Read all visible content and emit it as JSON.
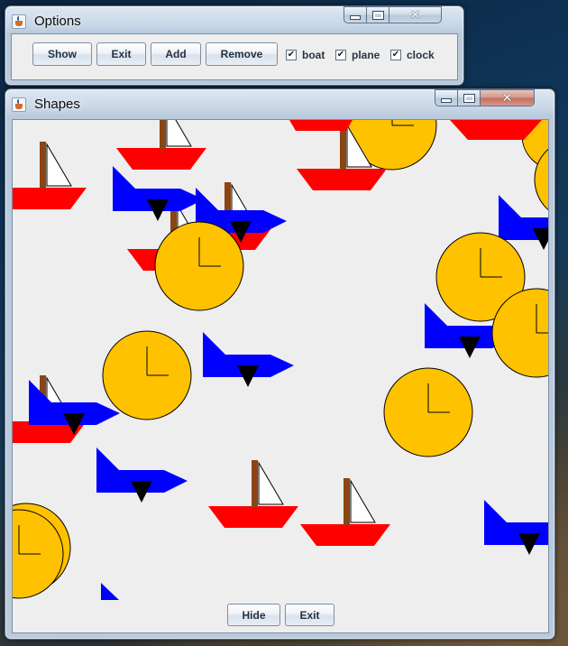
{
  "options_window": {
    "title": "Options",
    "buttons": {
      "show": "Show",
      "exit": "Exit",
      "add": "Add",
      "remove": "Remove"
    },
    "checkboxes": [
      {
        "label": "boat",
        "checked": true,
        "mark": "✔"
      },
      {
        "label": "plane",
        "checked": true,
        "mark": "✔"
      },
      {
        "label": "clock",
        "checked": true,
        "mark": "✔"
      }
    ]
  },
  "shapes_window": {
    "title": "Shapes",
    "buttons": {
      "hide": "Hide",
      "exit": "Exit"
    }
  },
  "caption_icons": {
    "minimize": "minimize-icon",
    "maximize": "maximize-icon",
    "close": "✕"
  },
  "colors": {
    "boat_hull": "#ff0000",
    "boat_mast": "#8b4513",
    "boat_sail": "#ffffff",
    "plane_body": "#0000ff",
    "plane_fin": "#000000",
    "clock_face": "#ffc200",
    "canvas_bg": "#eeeeee"
  }
}
